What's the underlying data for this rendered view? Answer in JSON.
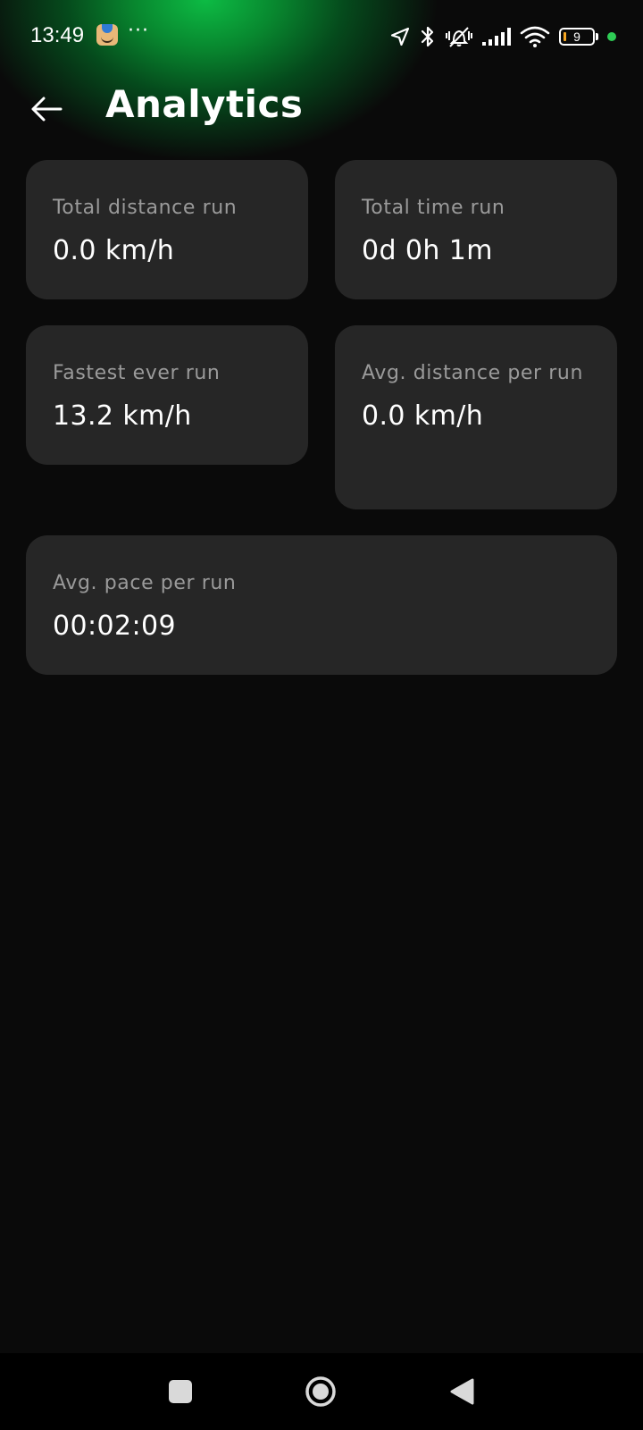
{
  "status_bar": {
    "time": "13:49",
    "more": "···",
    "battery": "9",
    "icons": [
      "app-notification-icon",
      "location-arrow-icon",
      "bluetooth-icon",
      "vibrate-off-icon",
      "signal-icon",
      "wifi-icon",
      "battery-icon",
      "privacy-dot-icon"
    ]
  },
  "header": {
    "title": "Analytics",
    "back_icon": "arrow-left-icon"
  },
  "stats": [
    {
      "label": "Total distance run",
      "value": "0.0 km/h"
    },
    {
      "label": "Total time run",
      "value": "0d 0h 1m"
    },
    {
      "label": "Fastest ever run",
      "value": "13.2 km/h"
    },
    {
      "label": "Avg. distance per run",
      "value": "0.0 km/h"
    },
    {
      "label": "Avg. pace per run",
      "value": "00:02:09"
    }
  ],
  "nav_bar": {
    "icons": [
      "recents-square-icon",
      "home-circle-icon",
      "back-triangle-icon"
    ]
  },
  "colors": {
    "background": "#0a0a0a",
    "card": "#262626",
    "label": "#9a9a9a",
    "accent_glow": "#0dbb44",
    "battery_level": "#f5a623",
    "privacy_dot": "#2ecc55"
  }
}
